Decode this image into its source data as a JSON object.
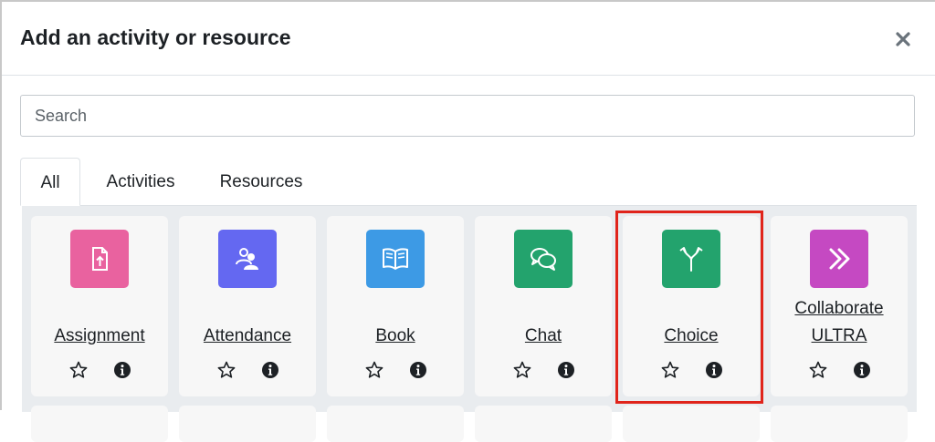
{
  "modal": {
    "title": "Add an activity or resource"
  },
  "search": {
    "placeholder": "Search"
  },
  "tabs": [
    {
      "label": "All",
      "active": true
    },
    {
      "label": "Activities",
      "active": false
    },
    {
      "label": "Resources",
      "active": false
    }
  ],
  "activities": [
    {
      "name": "Assignment",
      "icon": "assignment-icon",
      "color": "#e9629f"
    },
    {
      "name": "Attendance",
      "icon": "attendance-icon",
      "color": "#6468f1"
    },
    {
      "name": "Book",
      "icon": "book-icon",
      "color": "#3d9ae5"
    },
    {
      "name": "Chat",
      "icon": "chat-icon",
      "color": "#23a36d"
    },
    {
      "name": "Choice",
      "icon": "choice-icon",
      "color": "#23a36d"
    },
    {
      "name_line1": "Collaborate",
      "name_line2": "ULTRA",
      "icon": "collaborate-icon",
      "color": "#c549c2"
    }
  ],
  "colors": {
    "highlight": "#e0241b",
    "grid_background": "#e9ecef"
  }
}
